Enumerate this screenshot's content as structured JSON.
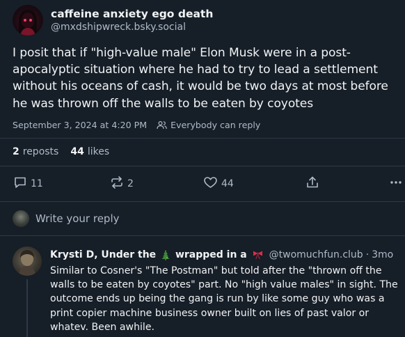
{
  "post": {
    "author": {
      "display_name": "caffeine anxiety ego death",
      "handle": "@mxdshipwreck.bsky.social"
    },
    "text": "I posit that if \"high-value male\" Elon Musk were in a post-apocalyptic situation where he had to try to lead a settlement without his oceans of cash, it would be two days at most before he was thrown off the walls to be eaten by coyotes",
    "timestamp": "September 3, 2024 at 4:20 PM",
    "reply_setting": "Everybody can reply",
    "stats": {
      "reposts_count": "2",
      "reposts_label": "reposts",
      "likes_count": "44",
      "likes_label": "likes"
    },
    "actions": {
      "reply_count": "11",
      "repost_count": "2",
      "like_count": "44"
    }
  },
  "composer": {
    "placeholder": "Write your reply"
  },
  "reply": {
    "name_part1": "Krysti D, Under the",
    "name_part2": "wrapped in a",
    "handle": "@twomuchfun.club",
    "separator": "·",
    "time": "3mo",
    "text": "Similar to Cosner's \"The Postman\" but told after the \"thrown off the walls to be eaten by coyotes\" part. No \"high value males\" in sight. The outcome ends up being the gang is run by like some guy who was a print copier machine business owner built on lies of past valor or whatev. Been awhile."
  },
  "colors": {
    "background": "#161e27",
    "text_primary": "#f1f3f5",
    "text_secondary": "#aebbc9",
    "divider": "#2e3a47",
    "emoji_tree": "#3a8a3a",
    "emoji_bow": "#d6304a"
  },
  "icons": {
    "reply": "speech-bubble-icon",
    "repost": "repost-arrows-icon",
    "like": "heart-icon",
    "share": "share-upload-icon",
    "more": "ellipsis-icon",
    "audience": "people-icon",
    "tree_emoji": "christmas-tree-emoji",
    "bow_emoji": "ribbon-bow-emoji"
  }
}
